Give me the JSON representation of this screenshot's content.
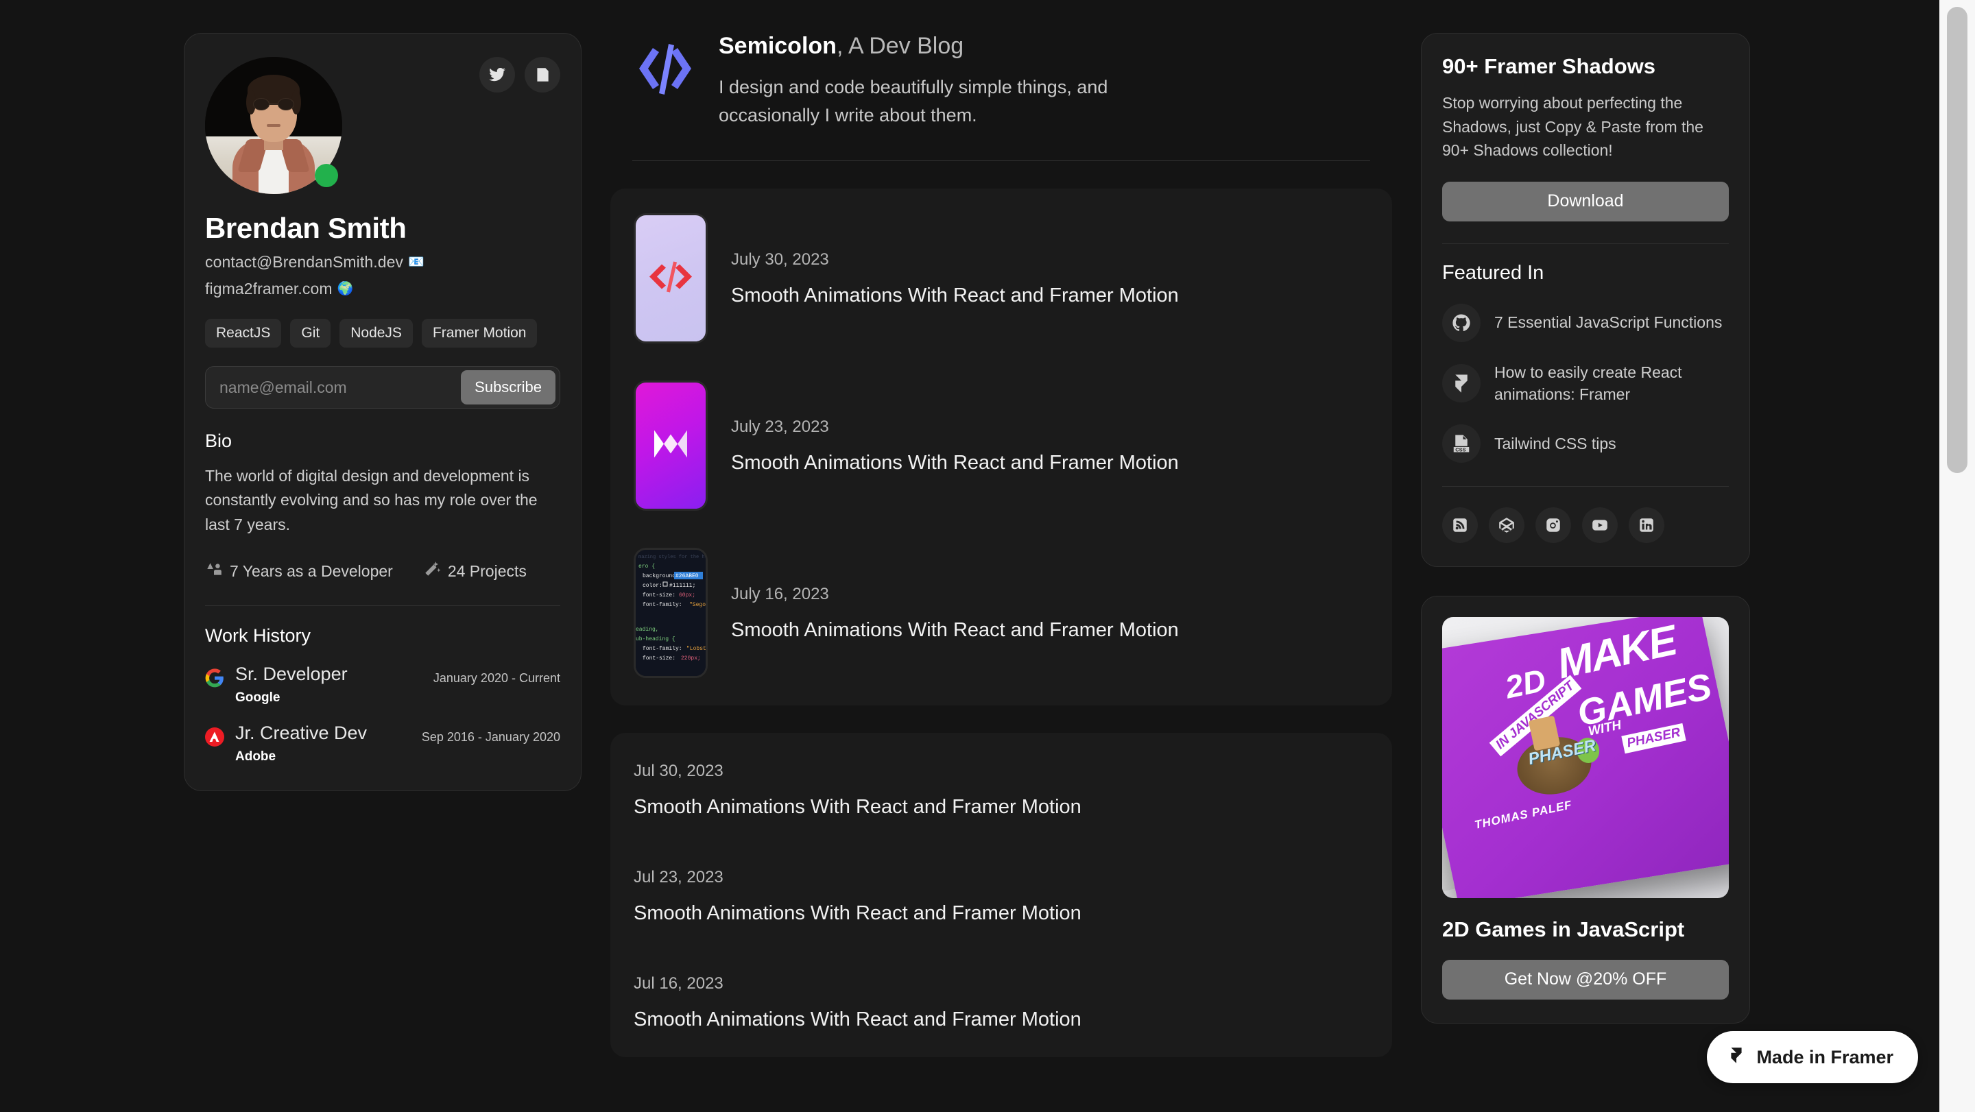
{
  "profile": {
    "name": "Brendan Smith",
    "email": "contact@BrendanSmith.dev",
    "email_emoji": "📧",
    "website": "figma2framer.com",
    "website_emoji": "🌍",
    "status": "online",
    "socials": [
      {
        "name": "twitter-icon",
        "label": "Twitter"
      },
      {
        "name": "article-icon",
        "label": "Articles"
      }
    ],
    "tags": [
      "ReactJS",
      "Git",
      "NodeJS",
      "Framer Motion"
    ],
    "subscribe": {
      "placeholder": "name@email.com",
      "value": "",
      "button_label": "Subscribe"
    },
    "bio_heading": "Bio",
    "bio_text": "The world of digital design and development is constantly evolving and so has my role over the last 7 years.",
    "stats": [
      {
        "icon": "people-icon",
        "label": "7 Years as a Developer"
      },
      {
        "icon": "magic-wand-icon",
        "label": "24 Projects"
      }
    ],
    "work_heading": "Work History",
    "jobs": [
      {
        "logo": "google-logo",
        "role": "Sr. Developer",
        "company": "Google",
        "dates": "January 2020 - Current"
      },
      {
        "logo": "adobe-logo",
        "role": "Jr. Creative Dev",
        "company": "Adobe",
        "dates": "Sep  2016 - January 2020"
      }
    ]
  },
  "blog": {
    "logo": "code-brackets-logo",
    "title_bold": "Semicolon",
    "title_rest": ", A Dev Blog",
    "description": "I design and code beautifully simple things, and occasionally I write about them.",
    "featured_posts": [
      {
        "thumb": "code-brackets-red-thumb",
        "date": "July 30, 2023",
        "title": "Smooth Animations With React and Framer Motion"
      },
      {
        "thumb": "framer-motion-magenta-thumb",
        "date": "July 23, 2023",
        "title": "Smooth Animations With React and Framer Motion"
      },
      {
        "thumb": "css-code-editor-thumb",
        "date": "July 16, 2023",
        "title": "Smooth Animations With React and Framer Motion"
      }
    ],
    "recent_posts": [
      {
        "date": "Jul 30, 2023",
        "title": "Smooth Animations With React and Framer Motion"
      },
      {
        "date": "Jul 23, 2023",
        "title": "Smooth Animations With React and Framer Motion"
      },
      {
        "date": "Jul 16, 2023",
        "title": "Smooth Animations With React and Framer Motion"
      }
    ]
  },
  "code_thumb": {
    "l0": "mazing styles for the hero s",
    "l1": "ero {",
    "l2a": "background:",
    "l2b": "#26ABE0",
    "l3a": "color:",
    "l3b": "#111111;",
    "l4a": "font-size:",
    "l4b": "60px;",
    "l5a": "font-family:",
    "l5b": "\"Segoe UI\";",
    "l6": "eading,",
    "l7": "ub-heading {",
    "l8a": "font-family:",
    "l8b": "\"Lobster\";",
    "l9a": "font-size:",
    "l9b": "220px;"
  },
  "promo": {
    "title": "90+ Framer Shadows",
    "description": "Stop worrying about perfecting the Shadows, just Copy & Paste from the 90+ Shadows collection!",
    "button_label": "Download"
  },
  "featured_in": {
    "heading": "Featured In",
    "items": [
      {
        "icon": "github-icon",
        "label": "7 Essential JavaScript Functions"
      },
      {
        "icon": "framer-icon",
        "label": "How to easily create React animations: Framer"
      },
      {
        "icon": "css-file-icon",
        "label": "Tailwind CSS tips"
      }
    ],
    "socials": [
      {
        "icon": "rss-icon",
        "label": "RSS"
      },
      {
        "icon": "codepen-icon",
        "label": "CodePen"
      },
      {
        "icon": "instagram-icon",
        "label": "Instagram"
      },
      {
        "icon": "youtube-icon",
        "label": "YouTube"
      },
      {
        "icon": "linkedin-icon",
        "label": "LinkedIn"
      }
    ]
  },
  "book": {
    "cover_text": {
      "make": "MAKE",
      "two_d": "2D",
      "games": "GAMES",
      "in_javascript": "IN JAVASCRIPT",
      "with": "WITH",
      "phaser": "PHASER",
      "author": "THOMAS PALEF",
      "logo": "PHASER"
    },
    "title": "2D Games in JavaScript",
    "button_label": "Get Now @20% OFF"
  },
  "framer_badge": {
    "label": "Made in Framer"
  },
  "colors": {
    "page_bg": "#141414",
    "card_bg": "#1d1d1d",
    "panel_bg": "#1b1b1b",
    "accent_blue": "#6c73f5",
    "button_gray": "#717171",
    "status_green": "#22b14c",
    "scrollbar_track": "#f7f7f7",
    "scrollbar_thumb": "#c2c2c2"
  }
}
